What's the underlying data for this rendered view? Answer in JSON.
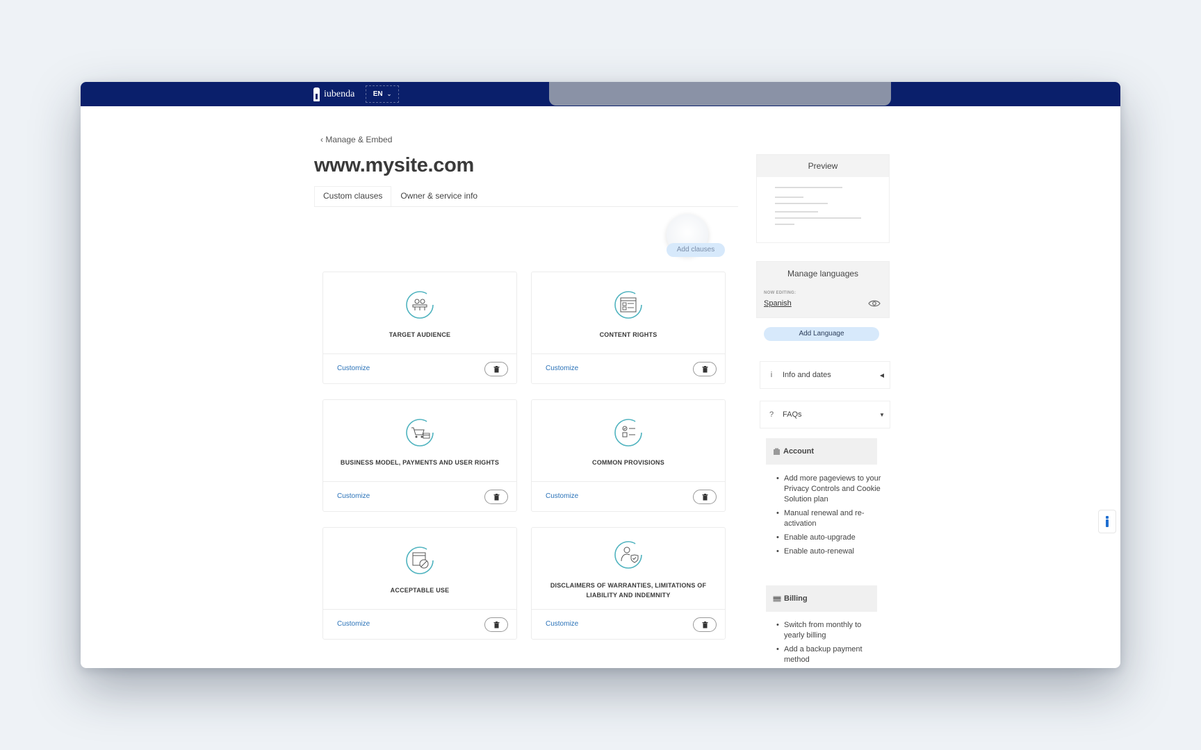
{
  "topbar": {
    "brand": "iubenda",
    "language_code": "EN"
  },
  "breadcrumb": "‹ Manage & Embed",
  "page_title": "www.mysite.com",
  "tabs": [
    {
      "label": "Custom clauses"
    },
    {
      "label": "Owner & service info"
    }
  ],
  "add_clauses_label": "Add clauses",
  "cards": [
    {
      "title": "TARGET AUDIENCE",
      "icon": "audience-icon",
      "customize": "Customize"
    },
    {
      "title": "CONTENT RIGHTS",
      "icon": "content-rights-icon",
      "customize": "Customize"
    },
    {
      "title": "BUSINESS MODEL, PAYMENTS AND USER RIGHTS",
      "icon": "cart-icon",
      "customize": "Customize"
    },
    {
      "title": "COMMON PROVISIONS",
      "icon": "checklist-icon",
      "customize": "Customize"
    },
    {
      "title": "ACCEPTABLE USE",
      "icon": "acceptable-use-icon",
      "customize": "Customize"
    },
    {
      "title": "DISCLAIMERS OF WARRANTIES, LIMITATIONS OF LIABILITY AND INDEMNITY",
      "icon": "user-shield-icon",
      "customize": "Customize"
    }
  ],
  "sidebar": {
    "preview_title": "Preview",
    "manage_languages_title": "Manage languages",
    "now_editing_label": "NOW EDITING:",
    "current_language": "Spanish",
    "add_language_label": "Add Language",
    "info_dates": {
      "icon_glyph": "i",
      "label": "Info and dates"
    },
    "faqs": {
      "icon_glyph": "?",
      "label": "FAQs"
    },
    "account": {
      "title": "Account",
      "items": [
        "Add more pageviews to your Privacy Controls and Cookie Solution plan",
        "Manual renewal and re-activation",
        "Enable auto-upgrade",
        "Enable auto-renewal"
      ]
    },
    "billing": {
      "title": "Billing",
      "items": [
        "Switch from monthly to yearly billing",
        "Add a backup payment method"
      ]
    }
  },
  "colors": {
    "topbar": "#0a1f6b",
    "accent_link": "#2a72b8",
    "pill_bg": "#d7e9fb",
    "icon_teal": "#4fb3bf"
  }
}
